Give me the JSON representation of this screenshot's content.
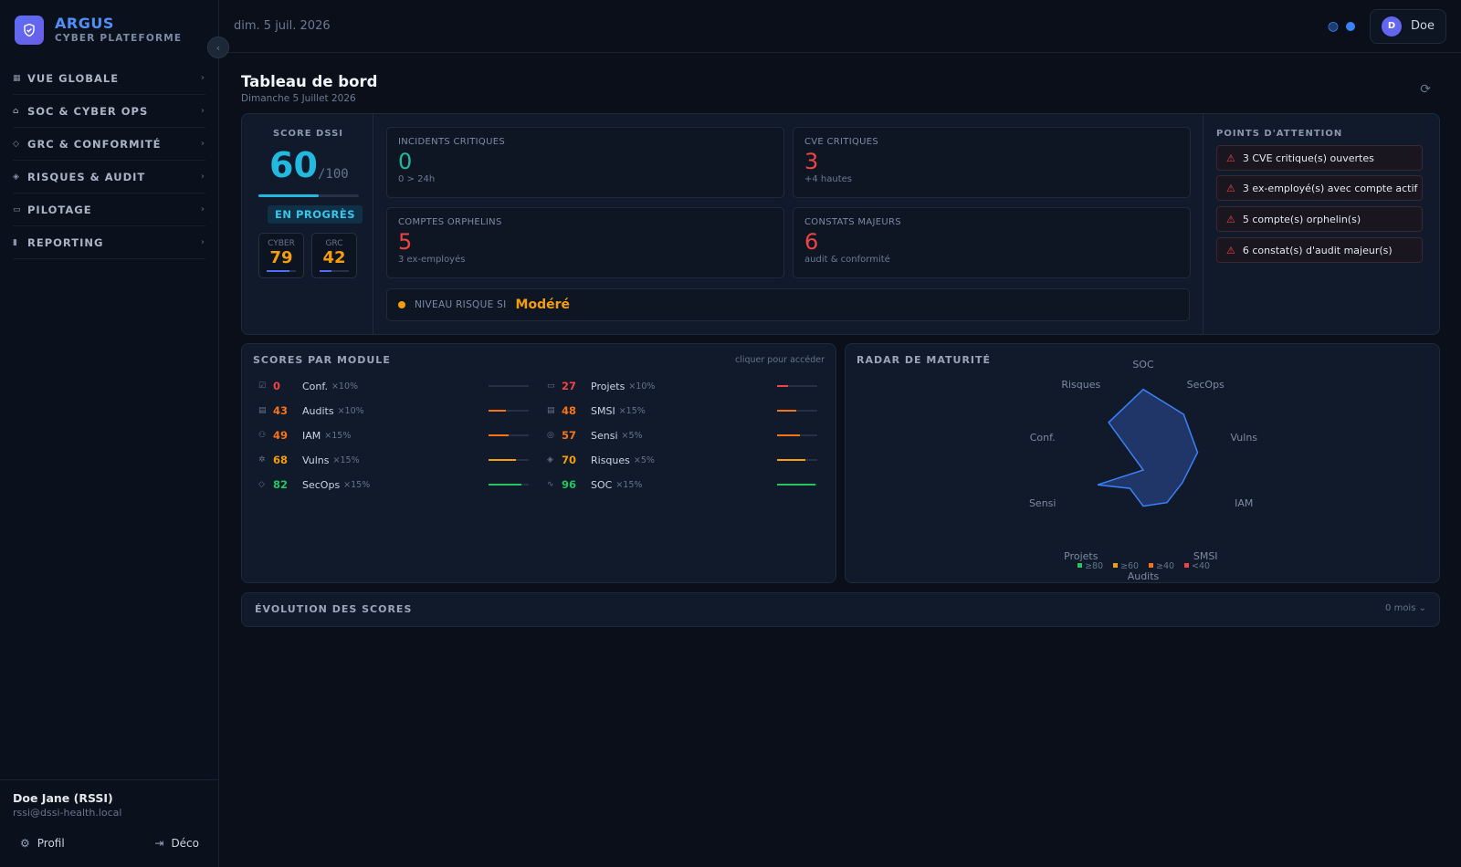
{
  "brand": {
    "title": "ARGUS",
    "subtitle": "CYBER PLATEFORME"
  },
  "sidebar": {
    "items": [
      {
        "label": "VUE GLOBALE",
        "icon": "grid-icon"
      },
      {
        "label": "SOC & CYBER OPS",
        "icon": "alarm-icon"
      },
      {
        "label": "GRC & CONFORMITÉ",
        "icon": "shield-icon"
      },
      {
        "label": "RISQUES & AUDIT",
        "icon": "shield-alert-icon"
      },
      {
        "label": "PILOTAGE",
        "icon": "briefcase-icon"
      },
      {
        "label": "REPORTING",
        "icon": "bar-chart-icon"
      }
    ],
    "user": {
      "name": "Doe Jane (RSSI)",
      "email": "rssi@dssi-health.local",
      "profile_label": "Profil",
      "logout_label": "Déco"
    }
  },
  "topbar": {
    "date": "dim. 5 juil. 2026",
    "avatar_initial": "D",
    "user_name": "Doe"
  },
  "page": {
    "title": "Tableau de bord",
    "subtitle": "Dimanche 5 Juillet 2026"
  },
  "score": {
    "label": "SCORE DSSI",
    "value": "60",
    "max": "/100",
    "progress": 0.6,
    "status": "EN PROGRÈS",
    "cyber": {
      "label": "CYBER",
      "value": "79",
      "progress": 0.79
    },
    "grc": {
      "label": "GRC",
      "value": "42",
      "progress": 0.42
    }
  },
  "kpis": [
    {
      "label": "INCIDENTS CRITIQUES",
      "value": "0",
      "sub": "0 > 24h",
      "color": "#22b8a0"
    },
    {
      "label": "CVE CRITIQUES",
      "value": "3",
      "sub": "+4 hautes",
      "color": "#ef4444"
    },
    {
      "label": "COMPTES ORPHELINS",
      "value": "5",
      "sub": "3 ex-employés",
      "color": "#ef4444"
    },
    {
      "label": "CONSTATS MAJEURS",
      "value": "6",
      "sub": "audit & conformité",
      "color": "#ef4444"
    }
  ],
  "risk": {
    "label": "NIVEAU RISQUE SI",
    "value": "Modéré"
  },
  "attention": {
    "title": "POINTS D'ATTENTION",
    "items": [
      "3 CVE critique(s) ouvertes",
      "3 ex-employé(s) avec compte actif",
      "5 compte(s) orphelin(s)",
      "6 constat(s) d'audit majeur(s)"
    ]
  },
  "modules": {
    "title": "SCORES PAR MODULE",
    "link": "cliquer pour accéder",
    "left": [
      {
        "value": "0",
        "name": "Conf.",
        "weight": "×10%",
        "color": "#ef4444",
        "score": 0
      },
      {
        "value": "43",
        "name": "Audits",
        "weight": "×10%",
        "color": "#f97316",
        "score": 43
      },
      {
        "value": "49",
        "name": "IAM",
        "weight": "×15%",
        "color": "#f97316",
        "score": 49
      },
      {
        "value": "68",
        "name": "Vulns",
        "weight": "×15%",
        "color": "#f59e0b",
        "score": 68
      },
      {
        "value": "82",
        "name": "SecOps",
        "weight": "×15%",
        "color": "#22c55e",
        "score": 82
      }
    ],
    "right": [
      {
        "value": "27",
        "name": "Projets",
        "weight": "×10%",
        "color": "#ef4444",
        "score": 27
      },
      {
        "value": "48",
        "name": "SMSI",
        "weight": "×15%",
        "color": "#f97316",
        "score": 48
      },
      {
        "value": "57",
        "name": "Sensi",
        "weight": "×5%",
        "color": "#f97316",
        "score": 57
      },
      {
        "value": "70",
        "name": "Risques",
        "weight": "×5%",
        "color": "#f59e0b",
        "score": 70
      },
      {
        "value": "96",
        "name": "SOC",
        "weight": "×15%",
        "color": "#22c55e",
        "score": 96
      }
    ]
  },
  "radar": {
    "title": "RADAR DE MATURITÉ",
    "axes": [
      "SOC",
      "SecOps",
      "Vulns",
      "IAM",
      "SMSI",
      "Audits",
      "Projets",
      "Sensi",
      "Conf.",
      "Risques"
    ],
    "values": [
      96,
      82,
      68,
      49,
      48,
      43,
      27,
      57,
      0,
      70
    ],
    "legend": [
      {
        "label": "≥80",
        "color": "#22c55e"
      },
      {
        "label": "≥60",
        "color": "#f59e0b"
      },
      {
        "label": "≥40",
        "color": "#f97316"
      },
      {
        "label": "<40",
        "color": "#ef4444"
      }
    ]
  },
  "evolution": {
    "title": "ÉVOLUTION DES SCORES",
    "range": "0 mois"
  }
}
